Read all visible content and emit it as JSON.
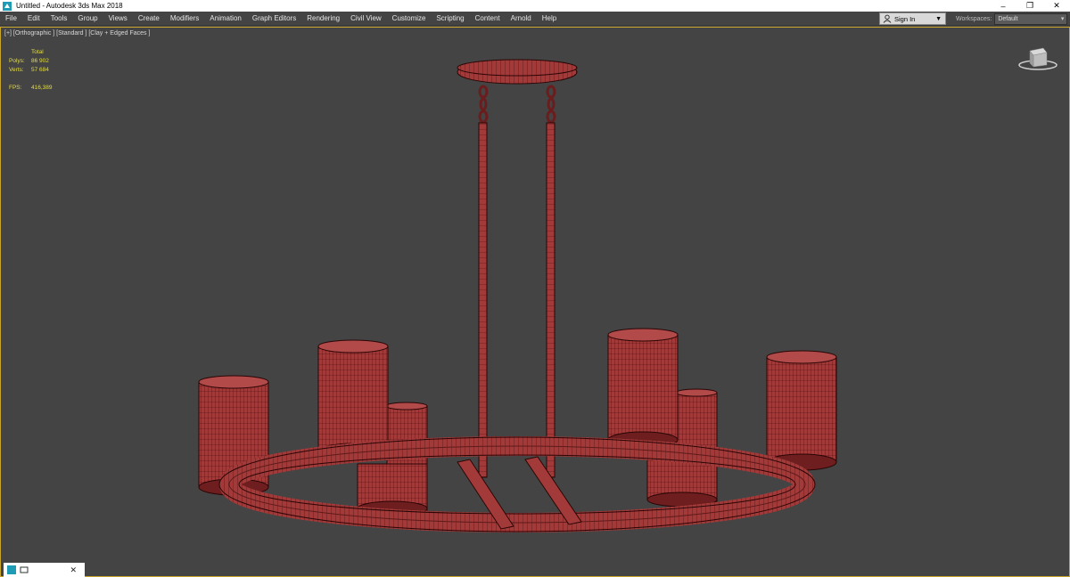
{
  "window": {
    "title": "Untitled - Autodesk 3ds Max 2018",
    "controls": [
      "–",
      "❐",
      "✕"
    ]
  },
  "menu": {
    "items": [
      "File",
      "Edit",
      "Tools",
      "Group",
      "Views",
      "Create",
      "Modifiers",
      "Animation",
      "Graph Editors",
      "Rendering",
      "Civil View",
      "Customize",
      "Scripting",
      "Content",
      "Arnold",
      "Help"
    ]
  },
  "account": {
    "signin_label": "Sign In",
    "workspaces_label": "Workspaces:",
    "workspace_value": "Default"
  },
  "viewport": {
    "label": "[+] [Orthographic ] [Standard ] [Clay + Edged Faces ]",
    "stats": {
      "total_label": "Total",
      "polys_label": "Polys:",
      "polys_value": "86 902",
      "verts_label": "Verts:",
      "verts_value": "57 684",
      "fps_label": "FPS:",
      "fps_value": "416,389"
    }
  },
  "colors": {
    "viewport_bg": "#444444",
    "model_fill": "#a33a3a",
    "model_wire": "#3a0a0a",
    "stats_text": "#e3dc48",
    "viewport_border": "#c8a62c"
  },
  "icons": {
    "app": "3dsmax-logo-icon",
    "user": "user-icon",
    "viewcube": "viewcube-icon"
  }
}
